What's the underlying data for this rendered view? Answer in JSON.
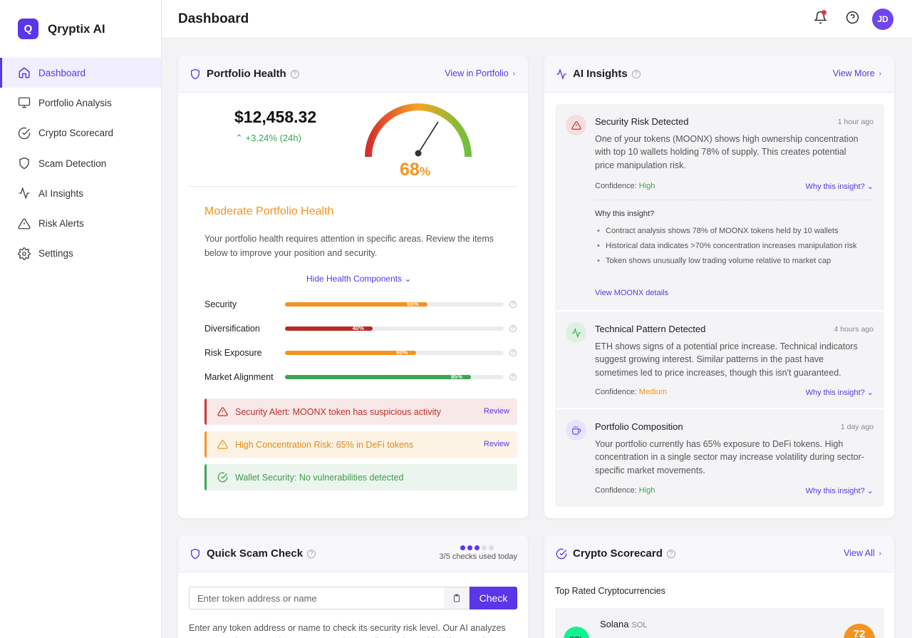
{
  "app": {
    "logo_letter": "Q",
    "name": "Qryptix AI"
  },
  "sidebar": {
    "items": [
      {
        "label": "Dashboard",
        "icon": "home-icon"
      },
      {
        "label": "Portfolio Analysis",
        "icon": "monitor-icon"
      },
      {
        "label": "Crypto Scorecard",
        "icon": "check-circle-icon"
      },
      {
        "label": "Scam Detection",
        "icon": "shield-icon"
      },
      {
        "label": "AI Insights",
        "icon": "activity-icon"
      },
      {
        "label": "Risk Alerts",
        "icon": "alert-triangle-icon"
      },
      {
        "label": "Settings",
        "icon": "gear-icon"
      }
    ]
  },
  "header": {
    "title": "Dashboard",
    "avatar_initials": "JD"
  },
  "portfolio": {
    "title": "Portfolio Health",
    "link": "View in Portfolio",
    "value": "$12,458.32",
    "change": "+3.24% (24h)",
    "health_pct": 68,
    "health_value": "68",
    "health_unit": "%",
    "status": "Moderate Portfolio Health",
    "description": "Your portfolio health requires attention in specific areas. Review the items below to improve your position and security.",
    "toggle": "Hide Health Components",
    "components": [
      {
        "label": "Security",
        "pct": 65,
        "pct_label": "65%",
        "color": "#f59320"
      },
      {
        "label": "Diversification",
        "pct": 40,
        "pct_label": "40%",
        "color": "#b82c24"
      },
      {
        "label": "Risk Exposure",
        "pct": 60,
        "pct_label": "60%",
        "color": "#f59320"
      },
      {
        "label": "Market Alignment",
        "pct": 85,
        "pct_label": "85%",
        "color": "#3aa655"
      }
    ],
    "alerts": [
      {
        "text": "Security Alert: MOONX token has suspicious activity",
        "action": "Review"
      },
      {
        "text": "High Concentration Risk: 65% in DeFi tokens",
        "action": "Review"
      },
      {
        "text": "Wallet Security: No vulnerabilities detected"
      }
    ]
  },
  "insights": {
    "title": "AI Insights",
    "link": "View More",
    "items": [
      {
        "title": "Security Risk Detected",
        "time": "1 hour ago",
        "body": "One of your tokens (MOONX) shows high ownership concentration with top 10 wallets holding 78% of supply. This creates potential price manipulation risk.",
        "conf_label": "Confidence:",
        "conf": "High",
        "why": "Why this insight?",
        "why_head": "Why this insight?",
        "why_points": [
          "Contract analysis shows 78% of MOONX tokens held by 10 wallets",
          "Historical data indicates >70% concentration increases manipulation risk",
          "Token shows unusually low trading volume relative to market cap"
        ],
        "why_link": "View MOONX details"
      },
      {
        "title": "Technical Pattern Detected",
        "time": "4 hours ago",
        "body": "ETH shows signs of a potential price increase. Technical indicators suggest growing interest. Similar patterns in the past have sometimes led to price increases, though this isn't guaranteed.",
        "conf_label": "Confidence:",
        "conf": "Medium",
        "why": "Why this insight?"
      },
      {
        "title": "Portfolio Composition",
        "time": "1 day ago",
        "body": "Your portfolio currently has 65% exposure to DeFi tokens. High concentration in a single sector may increase volatility during sector-specific market movements.",
        "conf_label": "Confidence:",
        "conf": "High",
        "why": "Why this insight?"
      }
    ]
  },
  "scam": {
    "title": "Quick Scam Check",
    "usage": "3/5 checks used today",
    "used": 3,
    "total": 5,
    "placeholder": "Enter token address or name",
    "button": "Check",
    "help": "Enter any token address or name to check its security risk level. Our AI analyzes contract code, transaction patterns, and token distribution to identify potential"
  },
  "scorecard": {
    "title": "Crypto Scorecard",
    "link": "View All",
    "subtitle": "Top Rated Cryptocurrencies",
    "top": {
      "name": "Solana",
      "symbol": "SOL",
      "logo_text": "SOL",
      "score": "72"
    }
  }
}
